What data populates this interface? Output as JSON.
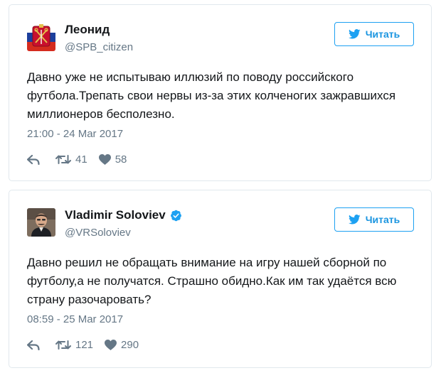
{
  "tweets": [
    {
      "name": "Леонид",
      "handle": "@SPB_citizen",
      "follow_label": "Читать",
      "text": "Давно уже не испытываю иллюзий по поводу российского футбола.Трепать свои нервы из-за этих колченогих зажравшихся миллионеров бесполезно.",
      "time": "21:00 - 24 Mar 2017",
      "retweets": "41",
      "likes": "58",
      "verified": false,
      "avatar_icon": "spb-coat-of-arms-icon"
    },
    {
      "name": "Vladimir Soloviev",
      "handle": "@VRSoloviev",
      "follow_label": "Читать",
      "text": "Давно решил не обращать внимание на игру нашей сборной по футболу,а не получатся. Страшно обидно.Как им так удаётся всю страну разочаровать?",
      "time": "08:59 - 25 Mar 2017",
      "retweets": "121",
      "likes": "290",
      "verified": true,
      "avatar_icon": "user-photo-icon"
    }
  ],
  "colors": {
    "accent": "#1da1f2",
    "text": "#14171a",
    "secondary": "#657786",
    "border": "#e1e8ed"
  }
}
